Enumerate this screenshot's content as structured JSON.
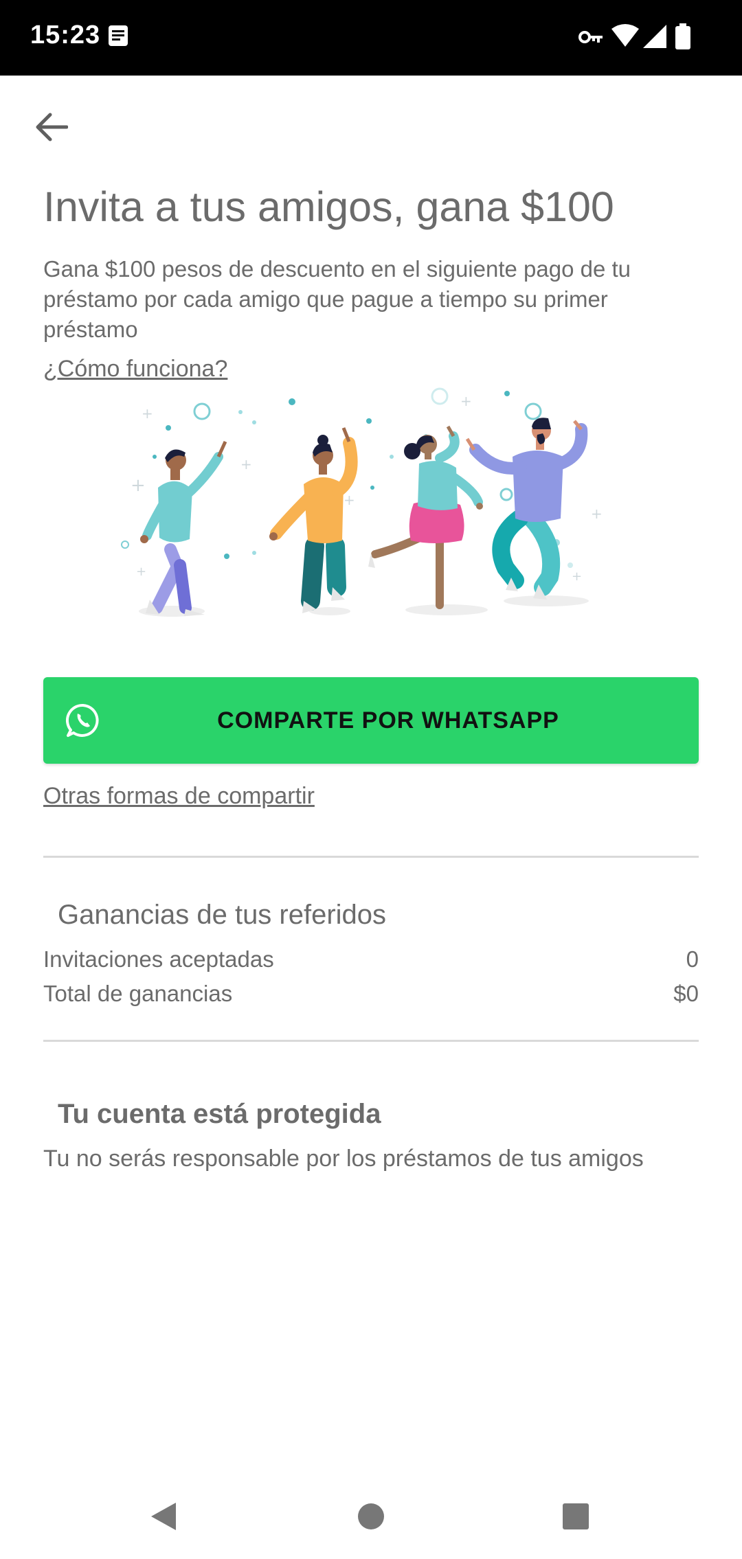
{
  "status_bar": {
    "time": "15:23",
    "icons": [
      "notification-icon",
      "vpn-key-icon",
      "wifi-icon",
      "signal-icon",
      "battery-icon"
    ]
  },
  "header": {
    "back_icon": "arrow-left-icon",
    "title": "Invita a tus amigos, gana $100",
    "description": "Gana $100 pesos de descuento en el siguiente pago de tu préstamo por cada amigo que pague a tiempo su primer préstamo",
    "how_it_works_link": "¿Cómo funciona?"
  },
  "share": {
    "whatsapp_button_label": "COMPARTE POR WHATSAPP",
    "whatsapp_icon": "whatsapp-icon",
    "other_share_link": "Otras formas de compartir",
    "button_color": "#2ad36a"
  },
  "earnings": {
    "title": "Ganancias de tus referidos",
    "rows": [
      {
        "label": "Invitaciones aceptadas",
        "value": "0"
      },
      {
        "label": "Total de ganancias",
        "value": "$0"
      }
    ]
  },
  "protection": {
    "title": "Tu cuenta está protegida",
    "description": "Tu no serás responsable por los préstamos de tus amigos"
  },
  "nav_bar": {
    "icons": [
      "back-triangle-icon",
      "home-circle-icon",
      "recents-square-icon"
    ]
  }
}
